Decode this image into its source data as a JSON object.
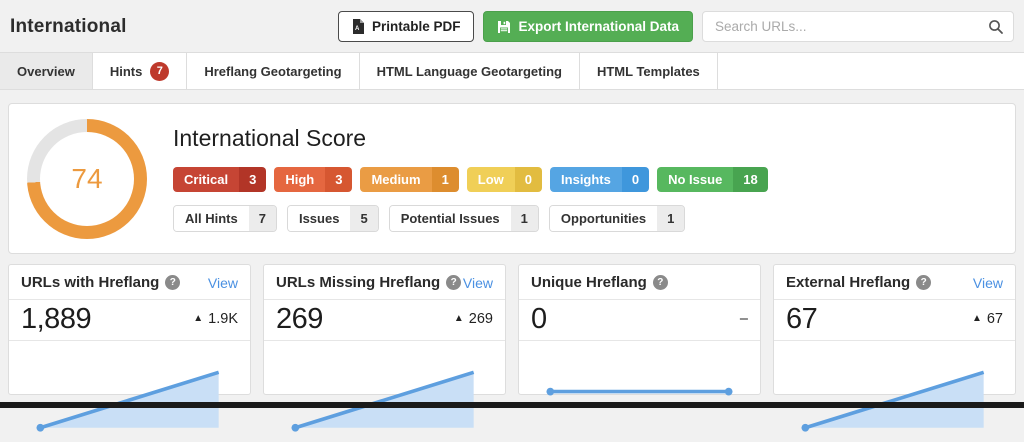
{
  "header": {
    "title": "International",
    "printable_pdf_label": "Printable PDF",
    "export_label": "Export International Data",
    "search_placeholder": "Search URLs..."
  },
  "tabs": [
    {
      "label": "Overview",
      "active": true
    },
    {
      "label": "Hints",
      "badge": "7"
    },
    {
      "label": "Hreflang Geotargeting"
    },
    {
      "label": "HTML Language Geotargeting"
    },
    {
      "label": "HTML Templates"
    }
  ],
  "score_panel": {
    "title": "International Score",
    "score": "74",
    "score_percent": 74,
    "severity_badges": [
      {
        "label": "Critical",
        "count": "3",
        "bg": "#c64534",
        "bg_dark": "#b23527"
      },
      {
        "label": "High",
        "count": "3",
        "bg": "#e56740",
        "bg_dark": "#d65731"
      },
      {
        "label": "Medium",
        "count": "1",
        "bg": "#ea9c44",
        "bg_dark": "#dd8d2f"
      },
      {
        "label": "Low",
        "count": "0",
        "bg": "#f0cf57",
        "bg_dark": "#e2bc40"
      },
      {
        "label": "Insights",
        "count": "0",
        "bg": "#55a5e3",
        "bg_dark": "#3f97dc"
      },
      {
        "label": "No Issue",
        "count": "18",
        "bg": "#57b85f",
        "bg_dark": "#48a450"
      }
    ],
    "filter_buttons": [
      {
        "label": "All Hints",
        "count": "7"
      },
      {
        "label": "Issues",
        "count": "5"
      },
      {
        "label": "Potential Issues",
        "count": "1"
      },
      {
        "label": "Opportunities",
        "count": "1"
      }
    ]
  },
  "cards": [
    {
      "title": "URLs with Hreflang",
      "view": "View",
      "value": "1,889",
      "delta_arrow": "▲",
      "delta": "1.9K",
      "spark": "rise"
    },
    {
      "title": "URLs Missing Hreflang",
      "view": "View",
      "value": "269",
      "delta_arrow": "▲",
      "delta": "269",
      "spark": "rise"
    },
    {
      "title": "Unique Hreflang",
      "view": null,
      "value": "0",
      "delta_arrow": "",
      "delta": "–",
      "spark": "flat"
    },
    {
      "title": "External Hreflang",
      "view": "View",
      "value": "67",
      "delta_arrow": "▲",
      "delta": "67",
      "spark": "rise"
    }
  ],
  "icons": {
    "pdf": "pdf-file-icon",
    "export": "save-icon",
    "search": "search-icon",
    "help": "question-mark-icon"
  },
  "colors": {
    "accent_green": "#54ae54",
    "link_blue": "#4a90e2",
    "donut_orange": "#ec9a3f",
    "donut_track": "#e4e4e4",
    "hints_badge_red": "#be392b",
    "spark_line": "#5e9fdf",
    "spark_fill": "#c9dff6",
    "bottom_bar": "#1a1a1a"
  }
}
